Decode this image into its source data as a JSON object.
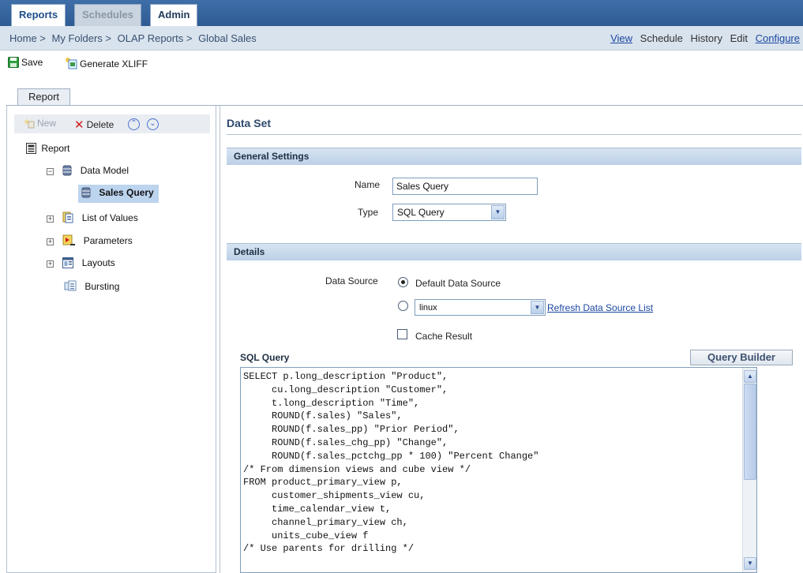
{
  "top_tabs": [
    {
      "label": "Reports",
      "state": "active"
    },
    {
      "label": "Schedules",
      "state": "inactive"
    },
    {
      "label": "Admin",
      "state": "normal"
    }
  ],
  "breadcrumb": [
    "Home >",
    "My Folders >",
    "OLAP Reports >",
    "Global Sales"
  ],
  "header_actions": {
    "view": "View",
    "schedule": "Schedule",
    "history": "History",
    "edit": "Edit",
    "configure": "Configure"
  },
  "toolbar": {
    "save_label": "Save",
    "generate_xliff_label": "Generate XLIFF"
  },
  "report_tab": "Report",
  "tree_toolbar": {
    "new_label": "New",
    "delete_label": "Delete"
  },
  "tree": {
    "root": "Report",
    "data_model": "Data Model",
    "sales_query": "Sales Query",
    "list_of_values": "List of Values",
    "parameters": "Parameters",
    "layouts": "Layouts",
    "bursting": "Bursting"
  },
  "main": {
    "title": "Data Set",
    "general_settings": "General Settings",
    "name_label": "Name",
    "name_value": "Sales Query",
    "type_label": "Type",
    "type_value": "SQL Query",
    "details": "Details",
    "data_source_label": "Data Source",
    "default_data_source": "Default Data Source",
    "data_source_select": "linux",
    "refresh_link": "Refresh Data Source List",
    "cache_result": "Cache Result",
    "sql_query_label": "SQL Query",
    "query_builder": "Query Builder",
    "sql_text": "SELECT p.long_description \"Product\",\n     cu.long_description \"Customer\",\n     t.long_description \"Time\",\n     ROUND(f.sales) \"Sales\",\n     ROUND(f.sales_pp) \"Prior Period\",\n     ROUND(f.sales_chg_pp) \"Change\",\n     ROUND(f.sales_pctchg_pp * 100) \"Percent Change\"\n/* From dimension views and cube view */\nFROM product_primary_view p,\n     customer_shipments_view cu,\n     time_calendar_view t,\n     channel_primary_view ch,\n     units_cube_view f\n/* Use parents for drilling */"
  },
  "colors": {
    "accent": "#2f5b93",
    "section_bg": "#bcd0e6",
    "selected_bg": "#bcd4ee"
  }
}
